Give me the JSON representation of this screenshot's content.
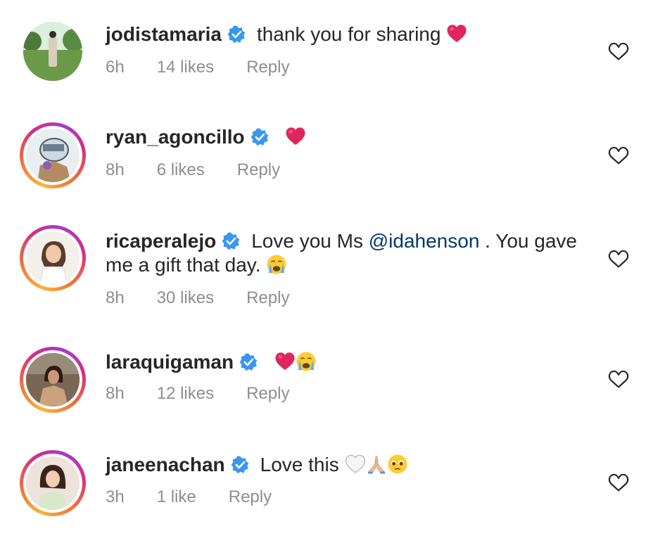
{
  "comments": [
    {
      "username": "jodistamaria",
      "text": "thank you for sharing",
      "emoji_after": [
        "red-heart"
      ],
      "time": "6h",
      "likes": "14 likes",
      "reply": "Reply",
      "avatar_ring": false
    },
    {
      "username": "ryan_agoncillo",
      "text": "",
      "emoji_after": [
        "red-heart"
      ],
      "time": "8h",
      "likes": "6 likes",
      "reply": "Reply",
      "avatar_ring": true
    },
    {
      "username": "ricaperalejo",
      "text_before": "Love you Ms",
      "mention": "@idahenson",
      "text_after": ". You gave",
      "text_line2": "me a gift that day.",
      "emoji_after": [
        "loudly-crying-face"
      ],
      "time": "8h",
      "likes": "30 likes",
      "reply": "Reply",
      "avatar_ring": true
    },
    {
      "username": "laraquigaman",
      "text": "",
      "emoji_after": [
        "red-heart",
        "loudly-crying-face"
      ],
      "time": "8h",
      "likes": "12 likes",
      "reply": "Reply",
      "avatar_ring": true
    },
    {
      "username": "janeenachan",
      "text": "Love this",
      "emoji_after": [
        "white-heart",
        "folded-hands",
        "pleading-face"
      ],
      "time": "3h",
      "likes": "1 like",
      "reply": "Reply",
      "avatar_ring": true
    }
  ],
  "colors": {
    "text": "#262626",
    "meta": "#8e8e8e",
    "verified": "#3897f0",
    "mention": "#00376b",
    "heart_emoji": "#e0245e"
  }
}
